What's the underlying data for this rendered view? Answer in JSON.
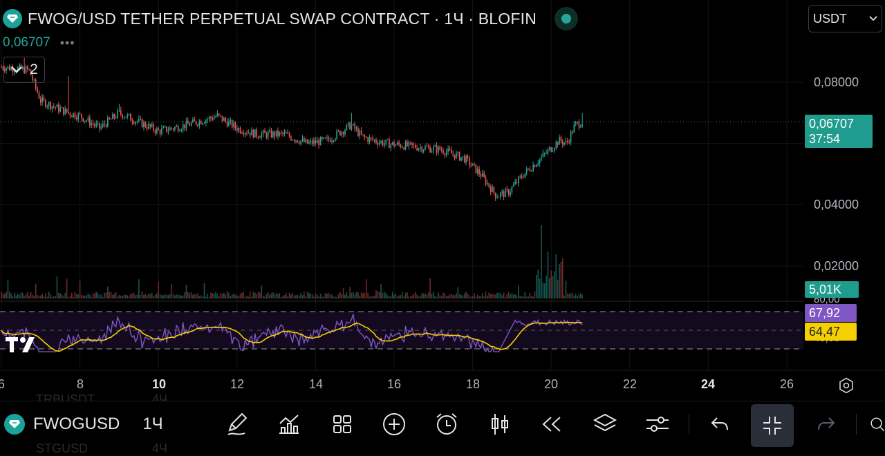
{
  "header": {
    "title": "FWOG/USD TETHER PERPETUAL SWAP CONTRACT · 1Ч · BLOFIN",
    "last_price": "0,06707",
    "more": "•••",
    "collapse_count": "2",
    "currency": "USDT"
  },
  "price_axis": {
    "labels": [
      "0,08000",
      "0,04000",
      "0,02000"
    ],
    "current_price": "0,06707",
    "countdown": "37:54",
    "volume_label": "5,01K",
    "rsi_value": "67,92",
    "rsi_ma_value": "64,47",
    "rsi_upper": "80,00",
    "rsi_lower": "40,00"
  },
  "time_axis": {
    "ticks": [
      {
        "label": "6",
        "bold": false
      },
      {
        "label": "8",
        "bold": false
      },
      {
        "label": "10",
        "bold": true
      },
      {
        "label": "12",
        "bold": false
      },
      {
        "label": "14",
        "bold": false
      },
      {
        "label": "16",
        "bold": false
      },
      {
        "label": "18",
        "bold": false
      },
      {
        "label": "20",
        "bold": false
      },
      {
        "label": "22",
        "bold": false
      },
      {
        "label": "24",
        "bold": true
      },
      {
        "label": "26",
        "bold": false
      }
    ]
  },
  "toolbar": {
    "symbol": "FWOGUSD",
    "interval": "1Ч",
    "ghost_top": "TRBUSDT",
    "ghost_top_interval": "4Ч",
    "ghost_bottom": "STGUSD",
    "ghost_bottom_interval": "4Ч"
  },
  "colors": {
    "up": "#26a69a",
    "down": "#ef5350",
    "rsi": "#7e57c2",
    "rsi_ma": "#f5d000",
    "background": "#000000"
  },
  "icons": [
    "drawing-pen-icon",
    "indicators-icon",
    "layouts-icon",
    "add-icon",
    "alert-clock-icon",
    "candles-icon",
    "replay-icon",
    "layers-icon",
    "settings-sliders-icon",
    "undo-icon",
    "exit-fullscreen-icon",
    "redo-icon"
  ],
  "chart_data": {
    "type": "candlestick",
    "x_axis": "date (day of month, hourly candles)",
    "x_range": [
      6,
      26
    ],
    "y_range": [
      0.016,
      0.096
    ],
    "close_path": [
      {
        "day": 6.0,
        "close": 0.085
      },
      {
        "day": 6.7,
        "close": 0.084
      },
      {
        "day": 7.0,
        "close": 0.074
      },
      {
        "day": 7.7,
        "close": 0.07
      },
      {
        "day": 8.0,
        "close": 0.069
      },
      {
        "day": 8.5,
        "close": 0.065
      },
      {
        "day": 9.0,
        "close": 0.07
      },
      {
        "day": 9.5,
        "close": 0.067
      },
      {
        "day": 10.0,
        "close": 0.064
      },
      {
        "day": 10.7,
        "close": 0.066
      },
      {
        "day": 11.5,
        "close": 0.069
      },
      {
        "day": 12.0,
        "close": 0.065
      },
      {
        "day": 12.5,
        "close": 0.063
      },
      {
        "day": 13.2,
        "close": 0.063
      },
      {
        "day": 13.8,
        "close": 0.06
      },
      {
        "day": 14.3,
        "close": 0.061
      },
      {
        "day": 14.9,
        "close": 0.066
      },
      {
        "day": 15.2,
        "close": 0.062
      },
      {
        "day": 15.8,
        "close": 0.06
      },
      {
        "day": 16.5,
        "close": 0.059
      },
      {
        "day": 17.2,
        "close": 0.058
      },
      {
        "day": 17.8,
        "close": 0.055
      },
      {
        "day": 18.2,
        "close": 0.05
      },
      {
        "day": 18.6,
        "close": 0.043
      },
      {
        "day": 18.9,
        "close": 0.044
      },
      {
        "day": 19.3,
        "close": 0.05
      },
      {
        "day": 19.8,
        "close": 0.056
      },
      {
        "day": 20.2,
        "close": 0.061
      },
      {
        "day": 20.4,
        "close": 0.06
      },
      {
        "day": 20.6,
        "close": 0.066
      },
      {
        "day": 20.8,
        "close": 0.06707
      }
    ]
  }
}
